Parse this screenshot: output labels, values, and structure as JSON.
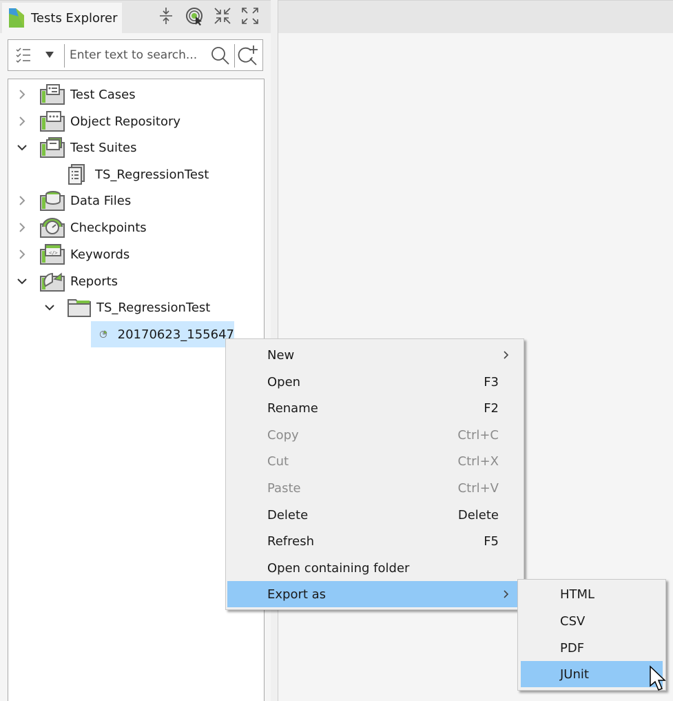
{
  "panel": {
    "tab_title": "Tests Explorer",
    "toolbar_icons": [
      "collapse-all-icon",
      "link-with-editor-icon",
      "minimize-icon",
      "maximize-icon"
    ]
  },
  "search": {
    "filter_icon": "checklist-filter-icon",
    "placeholder": "Enter text to search...",
    "value": ""
  },
  "tree": {
    "items": [
      {
        "label": "Test Cases",
        "icon": "test-cases-icon",
        "expanded": false,
        "level": 0
      },
      {
        "label": "Object Repository",
        "icon": "object-repository-icon",
        "expanded": false,
        "level": 0
      },
      {
        "label": "Test Suites",
        "icon": "test-suites-icon",
        "expanded": true,
        "level": 0
      },
      {
        "label": "TS_RegressionTest",
        "icon": "test-suite-file-icon",
        "level": 1
      },
      {
        "label": "Data Files",
        "icon": "data-files-icon",
        "expanded": false,
        "level": 0
      },
      {
        "label": "Checkpoints",
        "icon": "checkpoints-icon",
        "expanded": false,
        "level": 0
      },
      {
        "label": "Keywords",
        "icon": "keywords-icon",
        "expanded": false,
        "level": 0
      },
      {
        "label": "Reports",
        "icon": "reports-icon",
        "expanded": true,
        "level": 0
      },
      {
        "label": "TS_RegressionTest",
        "icon": "folder-icon",
        "expanded": true,
        "level": 1
      },
      {
        "label": "20170623_155647",
        "icon": "report-icon",
        "level": 2,
        "selected": true
      }
    ]
  },
  "context_menu": {
    "items": [
      {
        "label": "New",
        "shortcut": "",
        "submenu": true,
        "enabled": true
      },
      {
        "label": "Open",
        "shortcut": "F3",
        "enabled": true
      },
      {
        "label": "Rename",
        "shortcut": "F2",
        "enabled": true
      },
      {
        "label": "Copy",
        "shortcut": "Ctrl+C",
        "enabled": false
      },
      {
        "label": "Cut",
        "shortcut": "Ctrl+X",
        "enabled": false
      },
      {
        "label": "Paste",
        "shortcut": "Ctrl+V",
        "enabled": false
      },
      {
        "label": "Delete",
        "shortcut": "Delete",
        "enabled": true
      },
      {
        "label": "Refresh",
        "shortcut": "F5",
        "enabled": true
      },
      {
        "label": "Open containing folder",
        "shortcut": "",
        "enabled": true
      },
      {
        "label": "Export as",
        "shortcut": "",
        "submenu": true,
        "enabled": true,
        "highlighted": true
      }
    ]
  },
  "export_submenu": {
    "items": [
      {
        "label": "HTML"
      },
      {
        "label": "CSV"
      },
      {
        "label": "PDF"
      },
      {
        "label": "JUnit",
        "highlighted": true
      }
    ]
  },
  "colors": {
    "highlight": "#91c9f7",
    "selection": "#cce8ff",
    "brand_green": "#7cc242",
    "brand_blue": "#3d9ad6"
  }
}
